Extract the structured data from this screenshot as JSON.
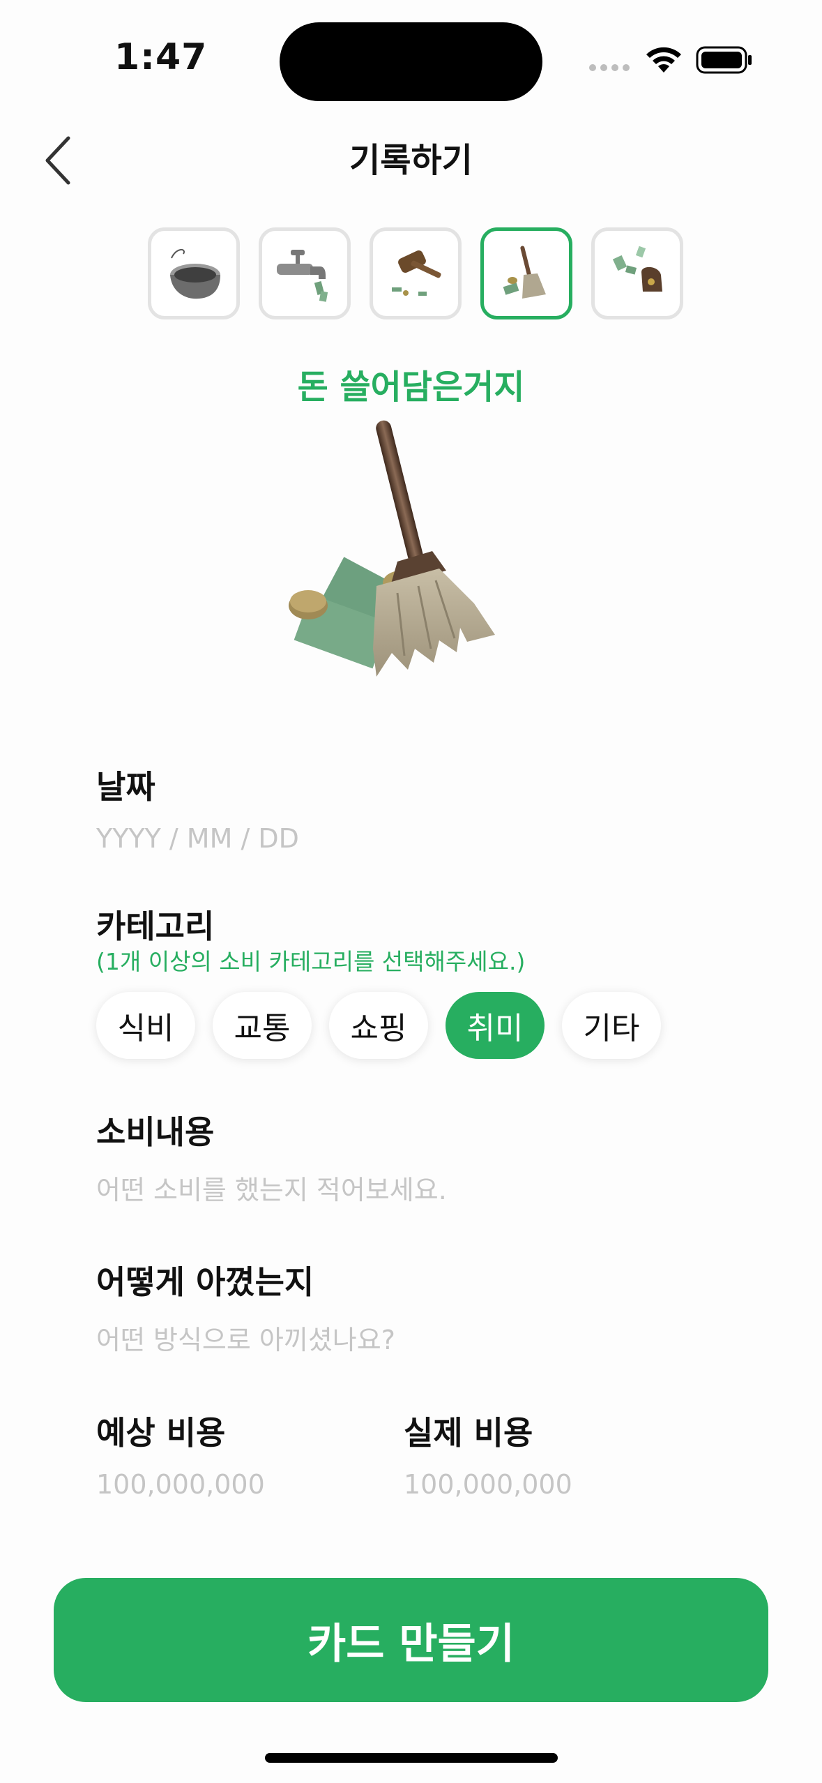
{
  "status_bar": {
    "time": "1:47"
  },
  "nav": {
    "title": "기록하기",
    "back_icon": "chevron-left-icon"
  },
  "type_picker": {
    "items": [
      {
        "icon": "bowl-icon",
        "selected": false
      },
      {
        "icon": "faucet-icon",
        "selected": false
      },
      {
        "icon": "gavel-icon",
        "selected": false
      },
      {
        "icon": "broom-icon",
        "selected": true
      },
      {
        "icon": "money-pouch-icon",
        "selected": false
      }
    ],
    "selected_name": "돈 쓸어담은거지"
  },
  "form": {
    "date": {
      "label": "날짜",
      "placeholder": "YYYY / MM / DD"
    },
    "category": {
      "label": "카테고리",
      "hint": "(1개 이상의 소비 카테고리를 선택해주세요.)",
      "options": [
        {
          "label": "식비",
          "selected": false
        },
        {
          "label": "교통",
          "selected": false
        },
        {
          "label": "쇼핑",
          "selected": false
        },
        {
          "label": "취미",
          "selected": true
        },
        {
          "label": "기타",
          "selected": false
        }
      ]
    },
    "content": {
      "label": "소비내용",
      "placeholder": "어떤 소비를 했는지 적어보세요."
    },
    "method": {
      "label": "어떻게 아꼈는지",
      "placeholder": "어떤 방식으로 아끼셨나요?"
    },
    "expected_cost": {
      "label": "예상 비용",
      "placeholder": "100,000,000"
    },
    "actual_cost": {
      "label": "실제 비용",
      "placeholder": "100,000,000"
    }
  },
  "submit_label": "카드 만들기",
  "colors": {
    "accent": "#27ae60",
    "placeholder": "#c5c5c5",
    "border": "#e3e3e3"
  }
}
